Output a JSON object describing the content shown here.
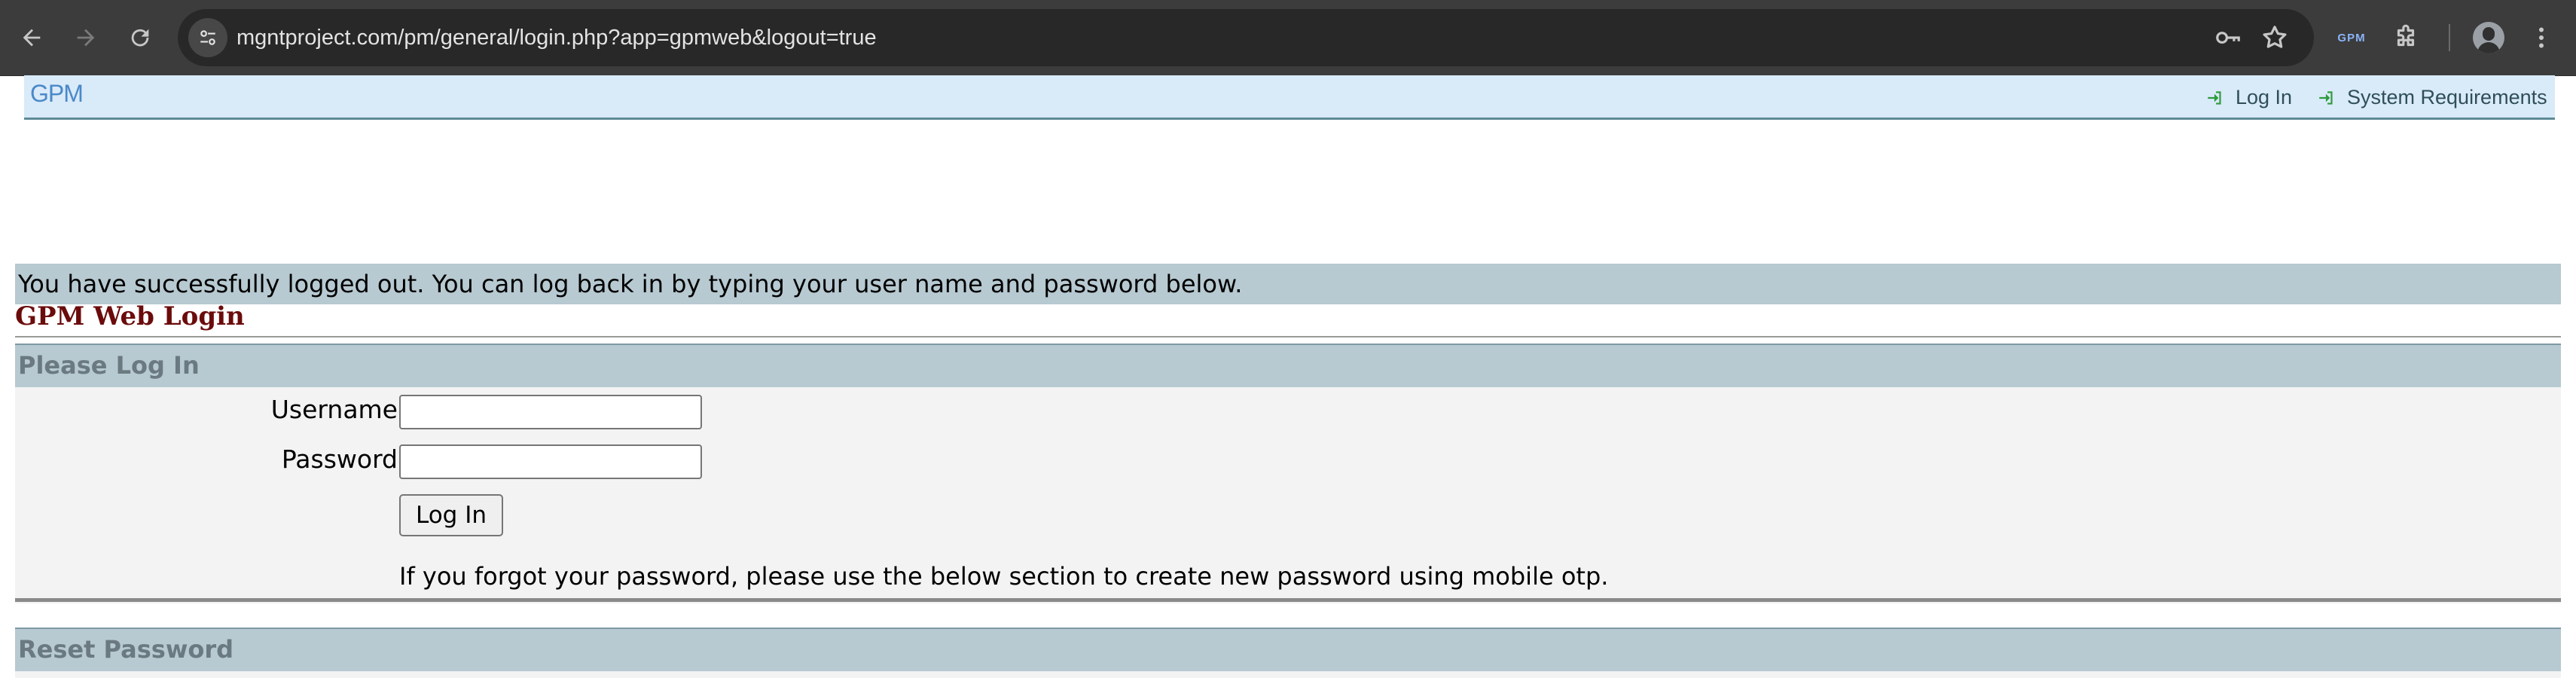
{
  "browser": {
    "url": "mgntproject.com/pm/general/login.php?app=gpmweb&logout=true",
    "extension_label": "GPM",
    "icons": {
      "back": "arrow-left",
      "forward": "arrow-right",
      "reload": "reload",
      "site_info": "tune",
      "password": "key",
      "bookmark": "star",
      "extensions": "puzzle",
      "profile": "avatar",
      "menu": "kebab"
    }
  },
  "header": {
    "logo": "GPM",
    "links": [
      {
        "label": "Log In",
        "icon": "sign-in"
      },
      {
        "label": "System Requirements",
        "icon": "sign-in"
      }
    ]
  },
  "message": "You have successfully logged out. You can log back in by typing your user name and password below.",
  "page_title": "GPM Web Login",
  "login": {
    "section_title": "Please Log In",
    "username_label": "Username",
    "username_value": "",
    "password_label": "Password",
    "password_value": "",
    "submit_label": "Log In",
    "forgot_note": "If you forgot your password, please use the below section to create new password using mobile otp."
  },
  "reset": {
    "section_title": "Reset Password"
  },
  "colors": {
    "chrome_bg": "#3c3c3c",
    "header_bg": "#d9eaf9",
    "section_bg": "#b7c9d1",
    "title_color": "#6b0b0b",
    "link_icon": "#2e9a3c"
  }
}
